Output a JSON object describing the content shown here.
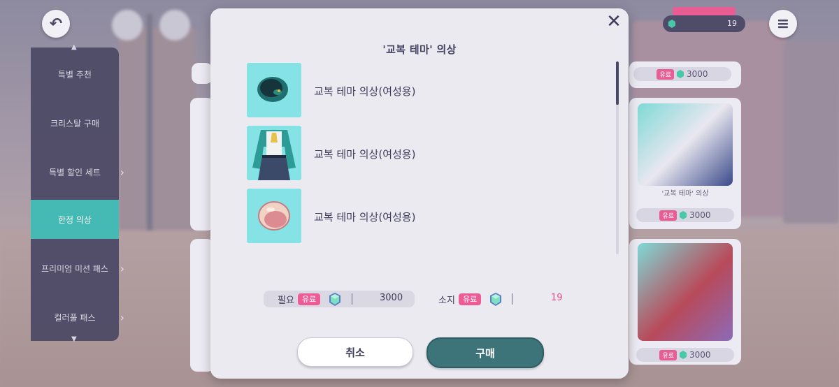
{
  "dialog": {
    "title": "'교복 테마' 의상",
    "close_icon": "close-icon",
    "items": [
      {
        "label": "교복 테마 의상(여성용)",
        "thumb_icon": "beret-hat-icon"
      },
      {
        "label": "교복 테마 의상(여성용)",
        "thumb_icon": "school-uniform-outfit-icon"
      },
      {
        "label": "교복 테마 의상(여성용)",
        "thumb_icon": "badge-accessory-icon"
      }
    ],
    "cost": {
      "required_label": "필요",
      "paid_badge": "유료",
      "required_value": "3000",
      "owned_label": "소지",
      "owned_badge": "유료",
      "owned_value": "19",
      "gem_icon": "crystal-gem-icon"
    },
    "buttons": {
      "cancel": "취소",
      "buy": "구매"
    }
  },
  "background": {
    "back_icon": "back-arrow-icon",
    "menu_icon": "hamburger-menu-icon",
    "side_menu": [
      "특별 추천",
      "크리스탈 구매",
      "특별 할인 세트",
      "한정 의상",
      "프리미엄 미션 패스",
      "컬러풀 패스"
    ],
    "cards": [
      {
        "price": "3000"
      },
      {
        "name": "'교복 테마' 의상",
        "price": "3000"
      },
      {
        "price": "3000"
      }
    ],
    "counter": "19"
  },
  "colors": {
    "accent_teal": "#3d7479",
    "paid_pink": "#ee5c98",
    "thumb_bg": "#86e3e5",
    "dialog_bg": "#ebeaf1"
  }
}
